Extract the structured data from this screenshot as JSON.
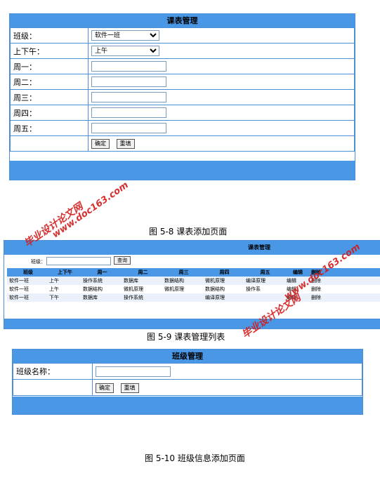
{
  "fig58": {
    "title": "课表管理",
    "rows": [
      {
        "label": "班级：",
        "type": "select",
        "value": "软件一班"
      },
      {
        "label": "上下午：",
        "type": "select",
        "value": "上午"
      },
      {
        "label": "周一：",
        "type": "input",
        "value": ""
      },
      {
        "label": "周二：",
        "type": "input",
        "value": ""
      },
      {
        "label": "周三：",
        "type": "input",
        "value": ""
      },
      {
        "label": "周四：",
        "type": "input",
        "value": ""
      },
      {
        "label": "周五：",
        "type": "input",
        "value": ""
      }
    ],
    "confirm_label": "确定",
    "reset_label": "重填",
    "caption": "图 5-8 课表添加页面"
  },
  "fig59": {
    "title": "课表管理",
    "search_label": "班级：",
    "search_value": "",
    "query_label": "查询",
    "columns": [
      "班级",
      "上下午",
      "周一",
      "周二",
      "周三",
      "周四",
      "周五",
      "编辑",
      "删除"
    ],
    "rows": [
      [
        "软件一班",
        "上午",
        "操作系统",
        "数据库",
        "数据结构",
        "微机原理",
        "编译原理",
        "编辑",
        "删除"
      ],
      [
        "软件一班",
        "上午",
        "数据结构",
        "微机原理",
        "微机原理",
        "数据结构",
        "操作系",
        "编辑",
        "删除"
      ],
      [
        "软件一班",
        "下午",
        "数据库",
        "操作系统",
        "",
        "编译原理",
        "",
        "编辑",
        "删除"
      ]
    ],
    "caption": "图 5-9 课表管理列表"
  },
  "fig510": {
    "title": "班级管理",
    "name_label": "班级名称：",
    "name_value": "",
    "confirm_label": "确定",
    "reset_label": "重填",
    "caption": "图 5-10 班级信息添加页面"
  },
  "watermarks": {
    "line1": "毕业设计论文网",
    "line2": "www.doc163.com"
  },
  "colors": {
    "header_blue": "#4a97e6",
    "border_blue": "#4a8fd8",
    "watermark_red": "#d31a1a"
  }
}
